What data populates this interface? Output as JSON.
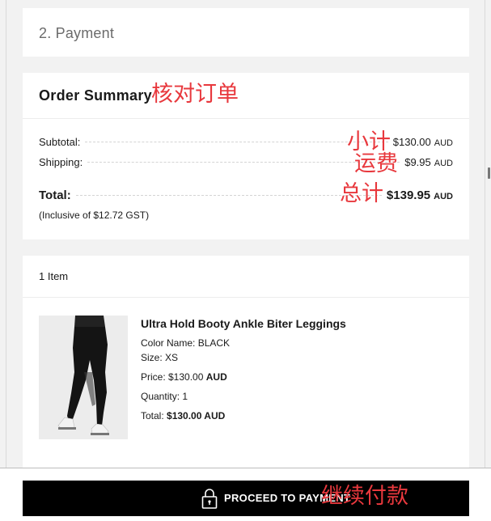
{
  "payment": {
    "title": "2. Payment"
  },
  "summary": {
    "title": "Order Summary",
    "title_annotation": "核对订单",
    "subtotal_label": "Subtotal:",
    "subtotal_value": "$130.00",
    "subtotal_currency": "AUD",
    "subtotal_annotation": "小计",
    "shipping_label": "Shipping:",
    "shipping_value": "$9.95",
    "shipping_currency": "AUD",
    "shipping_annotation": "运费",
    "total_label": "Total:",
    "total_value": "$139.95",
    "total_currency": "AUD",
    "total_annotation": "总计",
    "inclusive_note": "(Inclusive of $12.72 GST)"
  },
  "items": {
    "count_label": "1 Item",
    "list": [
      {
        "name": "Ultra Hold Booty Ankle Biter Leggings",
        "color_line": "Color Name: BLACK",
        "size_line": "Size: XS",
        "price_label": "Price: $130.00",
        "price_currency": "AUD",
        "quantity_line": "Quantity: 1",
        "total_label": "Total:",
        "total_value": "$130.00 AUD",
        "image": "product-photo-black-leggings"
      }
    ]
  },
  "checkout": {
    "button_label": "PROCEED TO PAYMENT",
    "button_annotation": "继续付款",
    "button_icon": "padlock-icon"
  },
  "colors": {
    "annotation": "#e8383d",
    "button_bg": "#000000",
    "page_bg": "#f2f2f2"
  }
}
